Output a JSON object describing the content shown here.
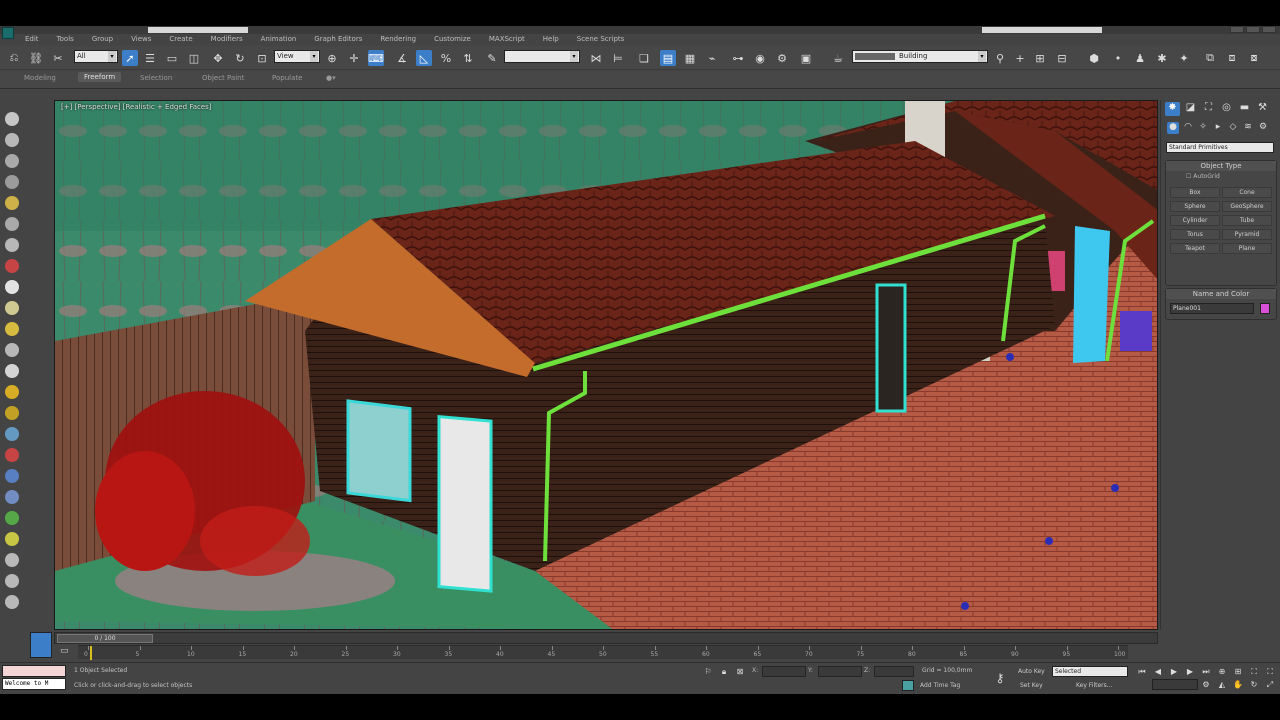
{
  "menu": [
    "Edit",
    "Tools",
    "Group",
    "Views",
    "Create",
    "Modifiers",
    "Animation",
    "Graph Editors",
    "Rendering",
    "Customize",
    "MAXScript",
    "Help",
    "Scene Scripts"
  ],
  "toolbar": {
    "selection_filter": "All",
    "reference_coord": "View",
    "named_selection": "",
    "layer_name": "Building"
  },
  "ribbon_tabs": [
    "Modeling",
    "Freeform",
    "Selection",
    "Object Paint",
    "Populate"
  ],
  "ribbon_active": "Freeform",
  "viewport": {
    "label": "[+] [Perspective] [Realistic + Edged Faces]"
  },
  "command_panel": {
    "category": "Standard Primitives",
    "object_type_title": "Object Type",
    "autogrid_label": "AutoGrid",
    "objects": [
      "Box",
      "Cone",
      "Sphere",
      "GeoSphere",
      "Cylinder",
      "Tube",
      "Torus",
      "Pyramid",
      "Teapot",
      "Plane"
    ],
    "name_color_title": "Name and Color",
    "object_name": "Plane001",
    "object_color": "#d84fd8"
  },
  "timeline": {
    "slider_label": "0 / 100",
    "ticks": [
      "0",
      "5",
      "10",
      "15",
      "20",
      "25",
      "30",
      "35",
      "40",
      "45",
      "50",
      "55",
      "60",
      "65",
      "70",
      "75",
      "80",
      "85",
      "90",
      "95",
      "100"
    ]
  },
  "status": {
    "maxscript_text": "Welcome to M",
    "selection_status": "1 Object Selected",
    "prompt": "Click or click-and-drag to select objects",
    "x_label": "X:",
    "y_label": "Y:",
    "z_label": "Z:",
    "grid": "Grid = 100,0mm",
    "add_time_tag": "Add Time Tag",
    "auto_key": "Auto Key",
    "set_key": "Set Key",
    "key_mode": "Selected",
    "key_filters": "Key Filters..."
  },
  "colors": {
    "accent": "#3d7ec9",
    "viewport_bg": "#2e7f5c"
  }
}
